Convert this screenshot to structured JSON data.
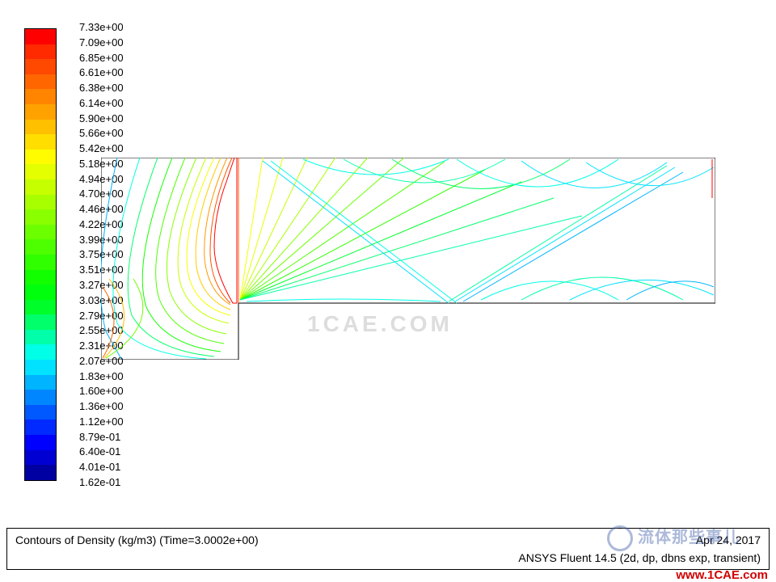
{
  "chart_data": {
    "type": "heatmap",
    "title": "Contours of Density (kg/m3)  (Time=3.0002e+00)",
    "variable": "Density",
    "units": "kg/m3",
    "time": 3.0002,
    "solver": "ANSYS Fluent 14.5 (2d, dp, dbns exp, transient)",
    "date": "Apr 24, 2017",
    "value_min": 0.162,
    "value_max": 7.33,
    "legend_labels": [
      "7.33e+00",
      "7.09e+00",
      "6.85e+00",
      "6.61e+00",
      "6.38e+00",
      "6.14e+00",
      "5.90e+00",
      "5.66e+00",
      "5.42e+00",
      "5.18e+00",
      "4.94e+00",
      "4.70e+00",
      "4.46e+00",
      "4.22e+00",
      "3.99e+00",
      "3.75e+00",
      "3.51e+00",
      "3.27e+00",
      "3.03e+00",
      "2.79e+00",
      "2.55e+00",
      "2.31e+00",
      "2.07e+00",
      "1.83e+00",
      "1.60e+00",
      "1.36e+00",
      "1.12e+00",
      "8.79e-01",
      "6.40e-01",
      "4.01e-01",
      "1.62e-01"
    ],
    "legend_colors": [
      "#ff0000",
      "#ff2a00",
      "#ff4800",
      "#ff6600",
      "#ff8400",
      "#ffa200",
      "#ffc000",
      "#ffde00",
      "#fffc00",
      "#e4ff00",
      "#c6ff00",
      "#a8ff00",
      "#8aff00",
      "#6cff00",
      "#4eff00",
      "#30ff00",
      "#12ff00",
      "#00ff0c",
      "#00ff2a",
      "#00ff6a",
      "#00ffa8",
      "#00ffe6",
      "#00e2ff",
      "#00b4ff",
      "#0086ff",
      "#0058ff",
      "#002aff",
      "#0000ff",
      "#0000d2",
      "#0000a2"
    ],
    "geometry": "forward-facing step duct, supersonic, bow shock and expansion fan visible"
  },
  "footer": {
    "title": "Contours of Density (kg/m3)  (Time=3.0002e+00)",
    "date": "Apr 24, 2017",
    "solver": "ANSYS Fluent 14.5 (2d, dp, dbns exp, transient)"
  },
  "watermarks": {
    "center_faint": "1CAE.COM",
    "bottom_right_cn": "流体那些事儿",
    "bottom_right_url": "www.1CAE.com"
  }
}
